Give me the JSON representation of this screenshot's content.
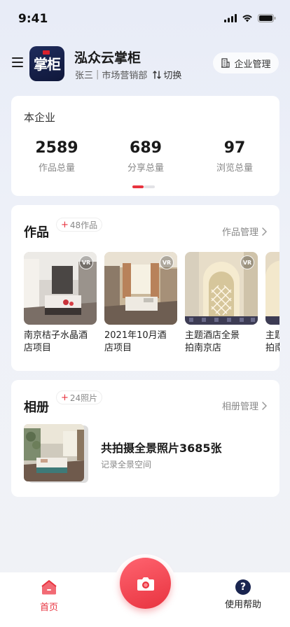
{
  "status_bar": {
    "time": "9:41"
  },
  "header": {
    "logo_text": "掌柜",
    "app_title": "泓众云掌柜",
    "user_name": "张三",
    "department": "市场营销部",
    "separator": "|",
    "switch_label": "切换",
    "enterprise_button": "企业管理"
  },
  "stats": {
    "title": "本企业",
    "items": [
      {
        "value": "2589",
        "label": "作品总量"
      },
      {
        "value": "689",
        "label": "分享总量"
      },
      {
        "value": "97",
        "label": "浏览总量"
      }
    ]
  },
  "works": {
    "title": "作品",
    "badge_plus": "+",
    "badge": "48作品",
    "manage_link": "作品管理",
    "vr_badge": "VR",
    "items": [
      {
        "label": "南京桔子水晶酒店项目",
        "line1": "南京桔子水晶酒",
        "line2": "店项目"
      },
      {
        "label": "2021年10月酒店项目",
        "line1": "2021年10月酒",
        "line2": "店项目"
      },
      {
        "label": "主题酒店全景拍南京店",
        "line1": "主题酒店全景",
        "line2": "拍南京店"
      },
      {
        "label": "主题",
        "line1": "主题",
        "line2": "拍南"
      }
    ]
  },
  "album": {
    "title": "相册",
    "badge_plus": "+",
    "badge": "24照片",
    "manage_link": "相册管理",
    "headline": "共拍摄全景照片3685张",
    "subtitle": "记录全景空间"
  },
  "tab_bar": {
    "home_label": "首页",
    "help_label": "使用帮助",
    "help_glyph": "?"
  },
  "colors": {
    "accent": "#e8333f",
    "logo_bg": "#1a2550"
  }
}
